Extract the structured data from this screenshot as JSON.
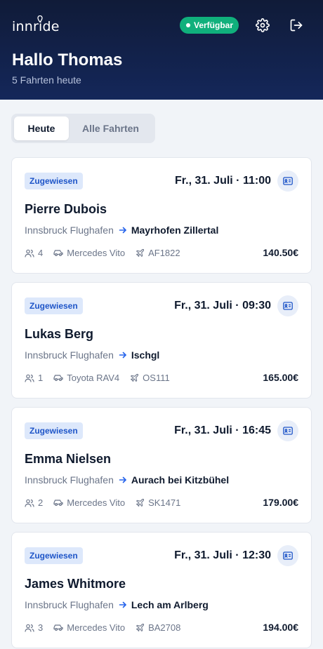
{
  "header": {
    "logo": "innride",
    "status": "Verfügbar",
    "greeting": "Hallo Thomas",
    "subtitle": "5 Fahrten heute"
  },
  "tabs": [
    {
      "label": "Heute",
      "active": true
    },
    {
      "label": "Alle Fahrten",
      "active": false
    }
  ],
  "rides": [
    {
      "status": "Zugewiesen",
      "datetime": "Fr., 31. Juli · 11:00",
      "name": "Pierre Dubois",
      "from": "Innsbruck Flughafen",
      "to": "Mayrhofen Zillertal",
      "passengers": "4",
      "vehicle": "Mercedes Vito",
      "flight": "AF1822",
      "price": "140.50€"
    },
    {
      "status": "Zugewiesen",
      "datetime": "Fr., 31. Juli · 09:30",
      "name": "Lukas Berg",
      "from": "Innsbruck Flughafen",
      "to": "Ischgl",
      "passengers": "1",
      "vehicle": "Toyota RAV4",
      "flight": "OS111",
      "price": "165.00€"
    },
    {
      "status": "Zugewiesen",
      "datetime": "Fr., 31. Juli · 16:45",
      "name": "Emma Nielsen",
      "from": "Innsbruck Flughafen",
      "to": "Aurach bei Kitzbühel",
      "passengers": "2",
      "vehicle": "Mercedes Vito",
      "flight": "SK1471",
      "price": "179.00€"
    },
    {
      "status": "Zugewiesen",
      "datetime": "Fr., 31. Juli · 12:30",
      "name": "James Whitmore",
      "from": "Innsbruck Flughafen",
      "to": "Lech am Arlberg",
      "passengers": "3",
      "vehicle": "Mercedes Vito",
      "flight": "BA2708",
      "price": "194.00€"
    }
  ],
  "icons": {
    "settings": "gear-icon",
    "logout": "logout-icon",
    "id_card": "id-card-icon",
    "passengers": "users-icon",
    "vehicle": "car-icon",
    "flight": "plane-icon",
    "route": "arrow-right-icon"
  },
  "colors": {
    "header": "#14275a",
    "status_available": "#10b07c",
    "badge_bg": "#dde8fb",
    "badge_text": "#1e55c8"
  }
}
